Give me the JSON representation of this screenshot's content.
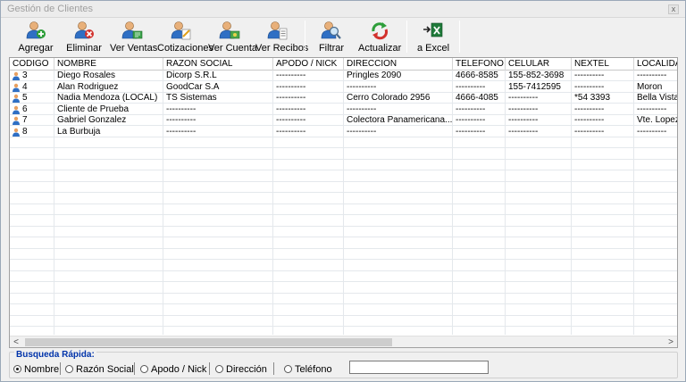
{
  "window": {
    "title": "Gestión de Clientes",
    "close_glyph": "x"
  },
  "toolbar": {
    "buttons": [
      {
        "label": "Agregar",
        "icon": "user-add-icon"
      },
      {
        "label": "Eliminar",
        "icon": "user-delete-icon"
      },
      {
        "label": "Ver Ventas",
        "icon": "user-sales-icon"
      },
      {
        "label": "Cotizaciones",
        "icon": "user-quotes-icon"
      },
      {
        "label": "Ver Cuenta",
        "icon": "user-account-icon"
      },
      {
        "label": "Ver Recibos",
        "icon": "user-receipts-icon"
      },
      {
        "label": "Filtrar",
        "icon": "filter-search-icon"
      },
      {
        "label": "Actualizar",
        "icon": "refresh-icon"
      },
      {
        "label": "a Excel",
        "icon": "excel-export-icon"
      }
    ]
  },
  "grid": {
    "columns": [
      "CODIGO",
      "NOMBRE",
      "RAZON SOCIAL",
      "APODO / NICK",
      "DIRECCION",
      "TELEFONO",
      "CELULAR",
      "NEXTEL",
      "LOCALIDA"
    ],
    "rows": [
      [
        "3",
        "Diego Rosales",
        "Dicorp S.R.L",
        "----------",
        "Pringles 2090",
        "4666-8585",
        "155-852-3698",
        "----------",
        "----------"
      ],
      [
        "4",
        "Alan Rodriguez",
        "GoodCar S.A",
        "----------",
        "----------",
        "----------",
        "155-7412595",
        "----------",
        "Moron"
      ],
      [
        "5",
        "Nadia Mendoza (LOCAL)",
        "TS Sistemas",
        "----------",
        "Cerro Colorado 2956",
        "4666-4085",
        "----------",
        "*54 3393",
        "Bella Vista"
      ],
      [
        "6",
        "Cliente de Prueba",
        "----------",
        "----------",
        "----------",
        "----------",
        "----------",
        "----------",
        "----------"
      ],
      [
        "7",
        "Gabriel Gonzalez",
        "----------",
        "----------",
        "Colectora Panamericana...",
        "----------",
        "----------",
        "----------",
        "Vte. Lopez"
      ],
      [
        "8",
        "La Burbuja",
        "----------",
        "----------",
        "----------",
        "----------",
        "----------",
        "----------",
        "----------"
      ]
    ],
    "scroll_left_glyph": "<",
    "scroll_right_glyph": ">"
  },
  "search": {
    "legend": "Busqueda Rápida:",
    "options": [
      "Nombre",
      "Razón Social",
      "Apodo / Nick",
      "Dirección",
      "Teléfono"
    ],
    "selected": "Nombre",
    "input_value": ""
  },
  "colors": {
    "legend": "#0033aa",
    "accent_green": "#2e9e3a",
    "accent_red": "#d2322d"
  }
}
